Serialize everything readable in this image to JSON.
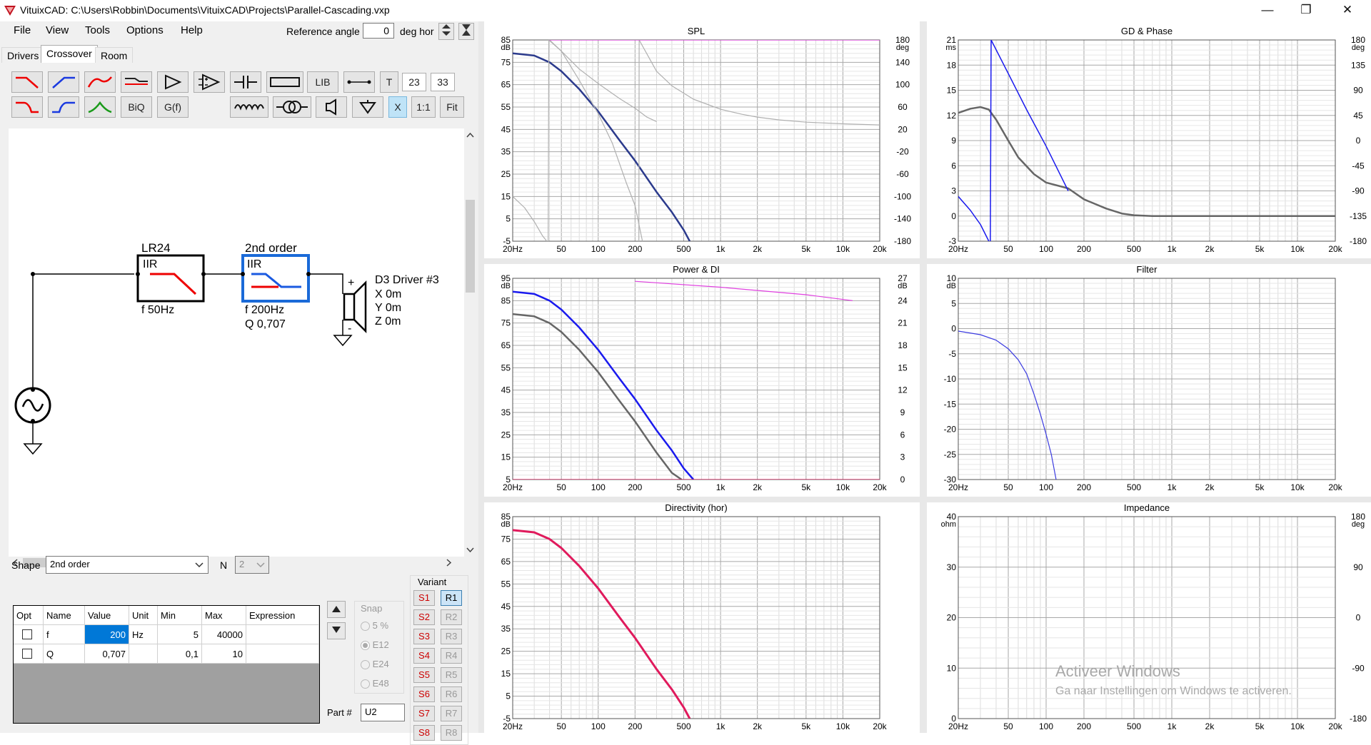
{
  "app": {
    "title": "VituixCAD: C:\\Users\\Robbin\\Documents\\VituixCAD\\Projects\\Parallel-Cascading.vxp",
    "win_min": "—",
    "win_restore": "❐",
    "win_close": "✕"
  },
  "menu": [
    "File",
    "View",
    "Tools",
    "Options",
    "Help"
  ],
  "reference": {
    "label": "Reference angle",
    "value": "0",
    "unit": "deg hor"
  },
  "tabs": [
    "Drivers",
    "Crossover",
    "Room"
  ],
  "toolbar": {
    "lib": "LIB",
    "t": "T",
    "n23": "23",
    "n33": "33",
    "biq": "BiQ",
    "gf": "G(f)",
    "x": "X",
    "one": "1:1",
    "fit": "Fit"
  },
  "schematic": {
    "block1": {
      "name": "LR24",
      "type": "IIR",
      "f": "f   50Hz"
    },
    "block2": {
      "name": "2nd order",
      "type": "IIR",
      "f": "f   200Hz",
      "q": "Q  0,707"
    },
    "driver": {
      "name": "D3 Driver #3",
      "x": "X 0m",
      "y": "Y 0m",
      "z": "Z 0m",
      "plus": "+",
      "minus": "-"
    }
  },
  "shape": {
    "label": "Shape",
    "value": "2nd order",
    "n_label": "N",
    "n_value": "2"
  },
  "params": {
    "headers": [
      "Opt",
      "Name",
      "Value",
      "Unit",
      "Min",
      "Max",
      "Expression"
    ],
    "rows": [
      {
        "name": "f",
        "value": "200",
        "unit": "Hz",
        "min": "5",
        "max": "40000",
        "expr": ""
      },
      {
        "name": "Q",
        "value": "0,707",
        "unit": "",
        "min": "0,1",
        "max": "10",
        "expr": ""
      }
    ]
  },
  "snap": {
    "label": "Snap",
    "options": [
      "5 %",
      "E12",
      "E24",
      "E48"
    ],
    "selected": "E12"
  },
  "part": {
    "label": "Part #",
    "value": "U2"
  },
  "variant": {
    "label": "Variant",
    "s": [
      "S1",
      "S2",
      "S3",
      "S4",
      "S5",
      "S6",
      "S7",
      "S8"
    ],
    "r": [
      "R1",
      "R2",
      "R3",
      "R4",
      "R5",
      "R6",
      "R7",
      "R8"
    ],
    "selected": "R1"
  },
  "xticks": [
    "20Hz",
    "50",
    "100",
    "200",
    "500",
    "1k",
    "2k",
    "5k",
    "10k",
    "20k"
  ],
  "colors": {
    "dark_blue": "#2b3a8c",
    "blue": "#1a1aee",
    "grey": "#666666",
    "light_grey": "#b0b0b0",
    "pink": "#e01a5c",
    "magenta": "#e040e0",
    "filter_blue": "#3a3ae0"
  },
  "chart_data": [
    {
      "type": "line",
      "title": "SPL",
      "xscale": "log",
      "xlim": [
        20,
        20000
      ],
      "ylabel": "dB",
      "ylim": [
        -5,
        85
      ],
      "yticks": [
        "85",
        "75",
        "65",
        "55",
        "45",
        "35",
        "25",
        "15",
        "5",
        "-5"
      ],
      "y2label": "deg",
      "y2lim": [
        -180,
        180
      ],
      "y2ticks": [
        "180",
        "140",
        "100",
        "60",
        "20",
        "-20",
        "-60",
        "-100",
        "-140",
        "-180"
      ],
      "series": [
        {
          "axis": "y",
          "color": "#2b3a8c",
          "width": 2.5,
          "points": [
            [
              20,
              79
            ],
            [
              30,
              78
            ],
            [
              40,
              75
            ],
            [
              50,
              71
            ],
            [
              70,
              63
            ],
            [
              100,
              53
            ],
            [
              150,
              40
            ],
            [
              200,
              31
            ],
            [
              300,
              17
            ],
            [
              400,
              8
            ],
            [
              500,
              0
            ],
            [
              560,
              -5
            ]
          ]
        },
        {
          "axis": "y",
          "color": "#b0b0b0",
          "width": 1.2,
          "points": [
            [
              40,
              85
            ],
            [
              50,
              80
            ],
            [
              70,
              67
            ],
            [
              100,
              52
            ],
            [
              130,
              39
            ],
            [
              170,
              21
            ],
            [
              200,
              11
            ],
            [
              230,
              -5
            ]
          ]
        },
        {
          "axis": "y2",
          "color": "#b0b0b0",
          "width": 1.2,
          "points": [
            [
              20,
              -100
            ],
            [
              25,
              -120
            ],
            [
              30,
              -145
            ],
            [
              35,
              -170
            ],
            [
              38,
              -180
            ]
          ]
        },
        {
          "axis": "y2",
          "color": "#b0b0b0",
          "width": 1.2,
          "points": [
            [
              39,
              -180
            ],
            [
              39.5,
              180
            ],
            [
              50,
              160
            ],
            [
              70,
              128
            ],
            [
              100,
              102
            ],
            [
              150,
              75
            ],
            [
              200,
              58
            ],
            [
              250,
              42
            ],
            [
              300,
              34
            ]
          ]
        },
        {
          "axis": "y2",
          "color": "#b0b0b0",
          "width": 1.2,
          "points": [
            [
              215,
              -180
            ],
            [
              216,
              180
            ],
            [
              300,
              124
            ],
            [
              400,
              98
            ],
            [
              600,
              74
            ],
            [
              1000,
              56
            ],
            [
              1500,
              47
            ],
            [
              2000,
              42
            ],
            [
              3000,
              37
            ],
            [
              5000,
              33
            ],
            [
              10000,
              30
            ],
            [
              20000,
              28
            ]
          ]
        },
        {
          "axis": "y2",
          "color": "#e040e0",
          "width": 1.2,
          "points": [
            [
              40,
              180
            ],
            [
              20000,
              180
            ]
          ]
        }
      ]
    },
    {
      "type": "line",
      "title": "GD & Phase",
      "xscale": "log",
      "xlim": [
        20,
        20000
      ],
      "ylabel": "ms",
      "ylim": [
        -3,
        21
      ],
      "yticks": [
        "21",
        "18",
        "15",
        "12",
        "9",
        "6",
        "3",
        "0",
        "-3"
      ],
      "y2label": "deg",
      "y2lim": [
        -180,
        180
      ],
      "y2ticks": [
        "180",
        "135",
        "90",
        "45",
        "0",
        "-45",
        "-90",
        "-135",
        "-180"
      ],
      "series": [
        {
          "axis": "y",
          "color": "#666666",
          "width": 2.5,
          "points": [
            [
              20,
              12.3
            ],
            [
              25,
              12.8
            ],
            [
              30,
              13
            ],
            [
              35,
              12.7
            ],
            [
              40,
              11.5
            ],
            [
              50,
              9
            ],
            [
              60,
              7
            ],
            [
              80,
              5
            ],
            [
              100,
              4
            ],
            [
              150,
              3.3
            ],
            [
              200,
              2
            ],
            [
              300,
              0.9
            ],
            [
              400,
              0.3
            ],
            [
              500,
              0.1
            ],
            [
              700,
              0
            ],
            [
              1000,
              0
            ],
            [
              20000,
              0
            ]
          ]
        },
        {
          "axis": "y2",
          "color": "#1a1aee",
          "width": 1.5,
          "points": [
            [
              20,
              -100
            ],
            [
              25,
              -125
            ],
            [
              30,
              -150
            ],
            [
              35,
              -180
            ]
          ]
        },
        {
          "axis": "y2",
          "color": "#1a1aee",
          "width": 1.5,
          "points": [
            [
              36,
              -180
            ],
            [
              36.5,
              180
            ],
            [
              50,
              120
            ],
            [
              70,
              55
            ],
            [
              100,
              -10
            ],
            [
              150,
              -90
            ]
          ]
        }
      ]
    },
    {
      "type": "line",
      "title": "Power & DI",
      "xscale": "log",
      "xlim": [
        20,
        20000
      ],
      "ylabel": "dB",
      "ylim": [
        5,
        95
      ],
      "yticks": [
        "95",
        "85",
        "75",
        "65",
        "55",
        "45",
        "35",
        "25",
        "15",
        "5"
      ],
      "y2label": "dB",
      "y2lim": [
        0,
        27
      ],
      "y2ticks": [
        "27",
        "24",
        "21",
        "18",
        "15",
        "12",
        "9",
        "6",
        "3",
        "0"
      ],
      "series": [
        {
          "axis": "y",
          "color": "#1a1aee",
          "width": 2.5,
          "points": [
            [
              20,
              89
            ],
            [
              30,
              88
            ],
            [
              40,
              85
            ],
            [
              50,
              81
            ],
            [
              70,
              73
            ],
            [
              100,
              63
            ],
            [
              150,
              50
            ],
            [
              200,
              41
            ],
            [
              300,
              27
            ],
            [
              400,
              18
            ],
            [
              500,
              10
            ],
            [
              600,
              5
            ]
          ]
        },
        {
          "axis": "y",
          "color": "#666666",
          "width": 2.5,
          "points": [
            [
              20,
              79
            ],
            [
              30,
              78
            ],
            [
              40,
              75
            ],
            [
              50,
              71
            ],
            [
              70,
              63
            ],
            [
              100,
              53
            ],
            [
              150,
              40
            ],
            [
              200,
              31
            ],
            [
              300,
              17
            ],
            [
              400,
              8
            ],
            [
              480,
              5
            ]
          ]
        },
        {
          "axis": "y2",
          "color": "#e040e0",
          "width": 1.2,
          "points": [
            [
              200,
              26.6
            ],
            [
              1000,
              25.8
            ],
            [
              5000,
              24.8
            ],
            [
              12000,
              24
            ]
          ]
        },
        {
          "axis": "y2",
          "color": "#e01a5c",
          "width": 1.2,
          "points": [
            [
              20,
              0
            ],
            [
              20000,
              0
            ]
          ]
        }
      ]
    },
    {
      "type": "line",
      "title": "Filter",
      "xscale": "log",
      "xlim": [
        20,
        20000
      ],
      "ylabel": "dB",
      "ylim": [
        -30,
        10
      ],
      "yticks": [
        "10",
        "5",
        "0",
        "-5",
        "-10",
        "-15",
        "-20",
        "-25",
        "-30"
      ],
      "series": [
        {
          "axis": "y",
          "color": "#3a3ae0",
          "width": 1.2,
          "points": [
            [
              20,
              -0.5
            ],
            [
              30,
              -1.2
            ],
            [
              40,
              -2.3
            ],
            [
              50,
              -4
            ],
            [
              60,
              -6.2
            ],
            [
              70,
              -9
            ],
            [
              80,
              -13
            ],
            [
              90,
              -17
            ],
            [
              100,
              -21
            ],
            [
              110,
              -25
            ],
            [
              120,
              -30
            ]
          ]
        }
      ]
    },
    {
      "type": "line",
      "title": "Directivity (hor)",
      "xscale": "log",
      "xlim": [
        20,
        20000
      ],
      "ylabel": "dB",
      "ylim": [
        -5,
        85
      ],
      "yticks": [
        "85",
        "75",
        "65",
        "55",
        "45",
        "35",
        "25",
        "15",
        "5",
        "-5"
      ],
      "series": [
        {
          "axis": "y",
          "color": "#e01a5c",
          "width": 3,
          "points": [
            [
              20,
              79
            ],
            [
              30,
              78
            ],
            [
              40,
              75
            ],
            [
              50,
              71
            ],
            [
              70,
              63
            ],
            [
              100,
              53
            ],
            [
              150,
              40
            ],
            [
              200,
              31
            ],
            [
              300,
              17
            ],
            [
              400,
              8
            ],
            [
              500,
              0
            ],
            [
              560,
              -5
            ]
          ]
        }
      ]
    },
    {
      "type": "line",
      "title": "Impedance",
      "xscale": "log",
      "xlim": [
        20,
        20000
      ],
      "ylabel": "ohm",
      "ylim": [
        0,
        40
      ],
      "yticks": [
        "40",
        "30",
        "20",
        "10",
        "0"
      ],
      "y2label": "deg",
      "y2lim": [
        -180,
        180
      ],
      "y2ticks": [
        "180",
        "90",
        "0",
        "-90",
        "-180"
      ],
      "series": []
    }
  ],
  "watermark": {
    "line1": "Activeer Windows",
    "line2": "Ga naar Instellingen om Windows te activeren."
  }
}
